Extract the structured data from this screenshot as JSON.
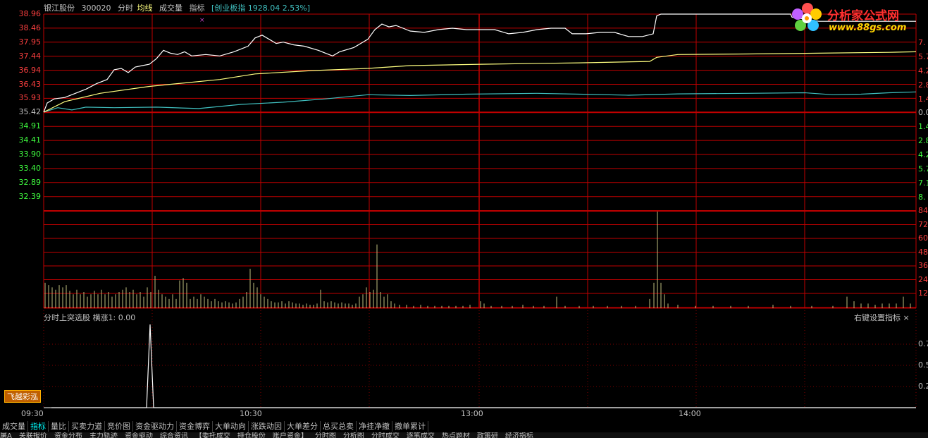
{
  "header": {
    "stock_name": "银江股份",
    "stock_code": "300020",
    "mode_label": "分时",
    "avg_label": "均线",
    "volume_label": "成交量",
    "indicator_label": "指标",
    "index_info": "[创业板指 1928.04 2.53%]"
  },
  "price_axis": [
    "38.96",
    "38.46",
    "37.95",
    "37.44",
    "36.94",
    "36.43",
    "35.93",
    "35.42",
    "34.91",
    "34.41",
    "33.90",
    "33.40",
    "32.89",
    "32.39"
  ],
  "pct_axis": [
    "7.",
    "5.7",
    "4.2",
    "2.8",
    "1.4",
    "0.0",
    "1.4",
    "2.8",
    "4.2",
    "5.7",
    "7.1",
    "8."
  ],
  "volume_axis": [
    "84",
    "72",
    "60",
    "48",
    "36",
    "24",
    "12"
  ],
  "sub_axis": [
    "0.7",
    "0.5",
    "0.2"
  ],
  "sub_panel": {
    "title": "分时上突选股  横涨1: 0.00",
    "right_label": "右键设置指标 ×"
  },
  "feiyue_button": "飞越彩泓",
  "time_axis": [
    "09:30",
    "10:30",
    "13:00",
    "14:00"
  ],
  "tabs": [
    "成交量",
    "指标",
    "量比",
    "买卖力道",
    "竞价图",
    "资金驱动力",
    "资金博弈",
    "大单动向",
    "涨跌动因",
    "大单差分",
    "总买总卖",
    "净挂净撤",
    "撤单累计"
  ],
  "active_tab": "指标",
  "bottom_items": [
    "屠A",
    "关联报价",
    "资金分布",
    "主力轨迹",
    "资金驱动",
    "综合资讯",
    "【委托成交",
    "持仓股份",
    "账户资金】",
    "分时图",
    "分析图",
    "分时成交",
    "逐笔成交",
    "热点题材",
    "政策研",
    "经济指标"
  ],
  "logo": {
    "brand_cn": "分析家公式网",
    "brand_url": "www.88gs.com"
  },
  "colors": {
    "grid": "#c00000",
    "price_line": "#ffffff",
    "avg_line": "#ffff80",
    "index_line": "#40c0c0",
    "volume_bars": "#c0c080",
    "up_text": "#ff4040",
    "down_text": "#40ff40",
    "active_tab": "#00ffff"
  }
}
